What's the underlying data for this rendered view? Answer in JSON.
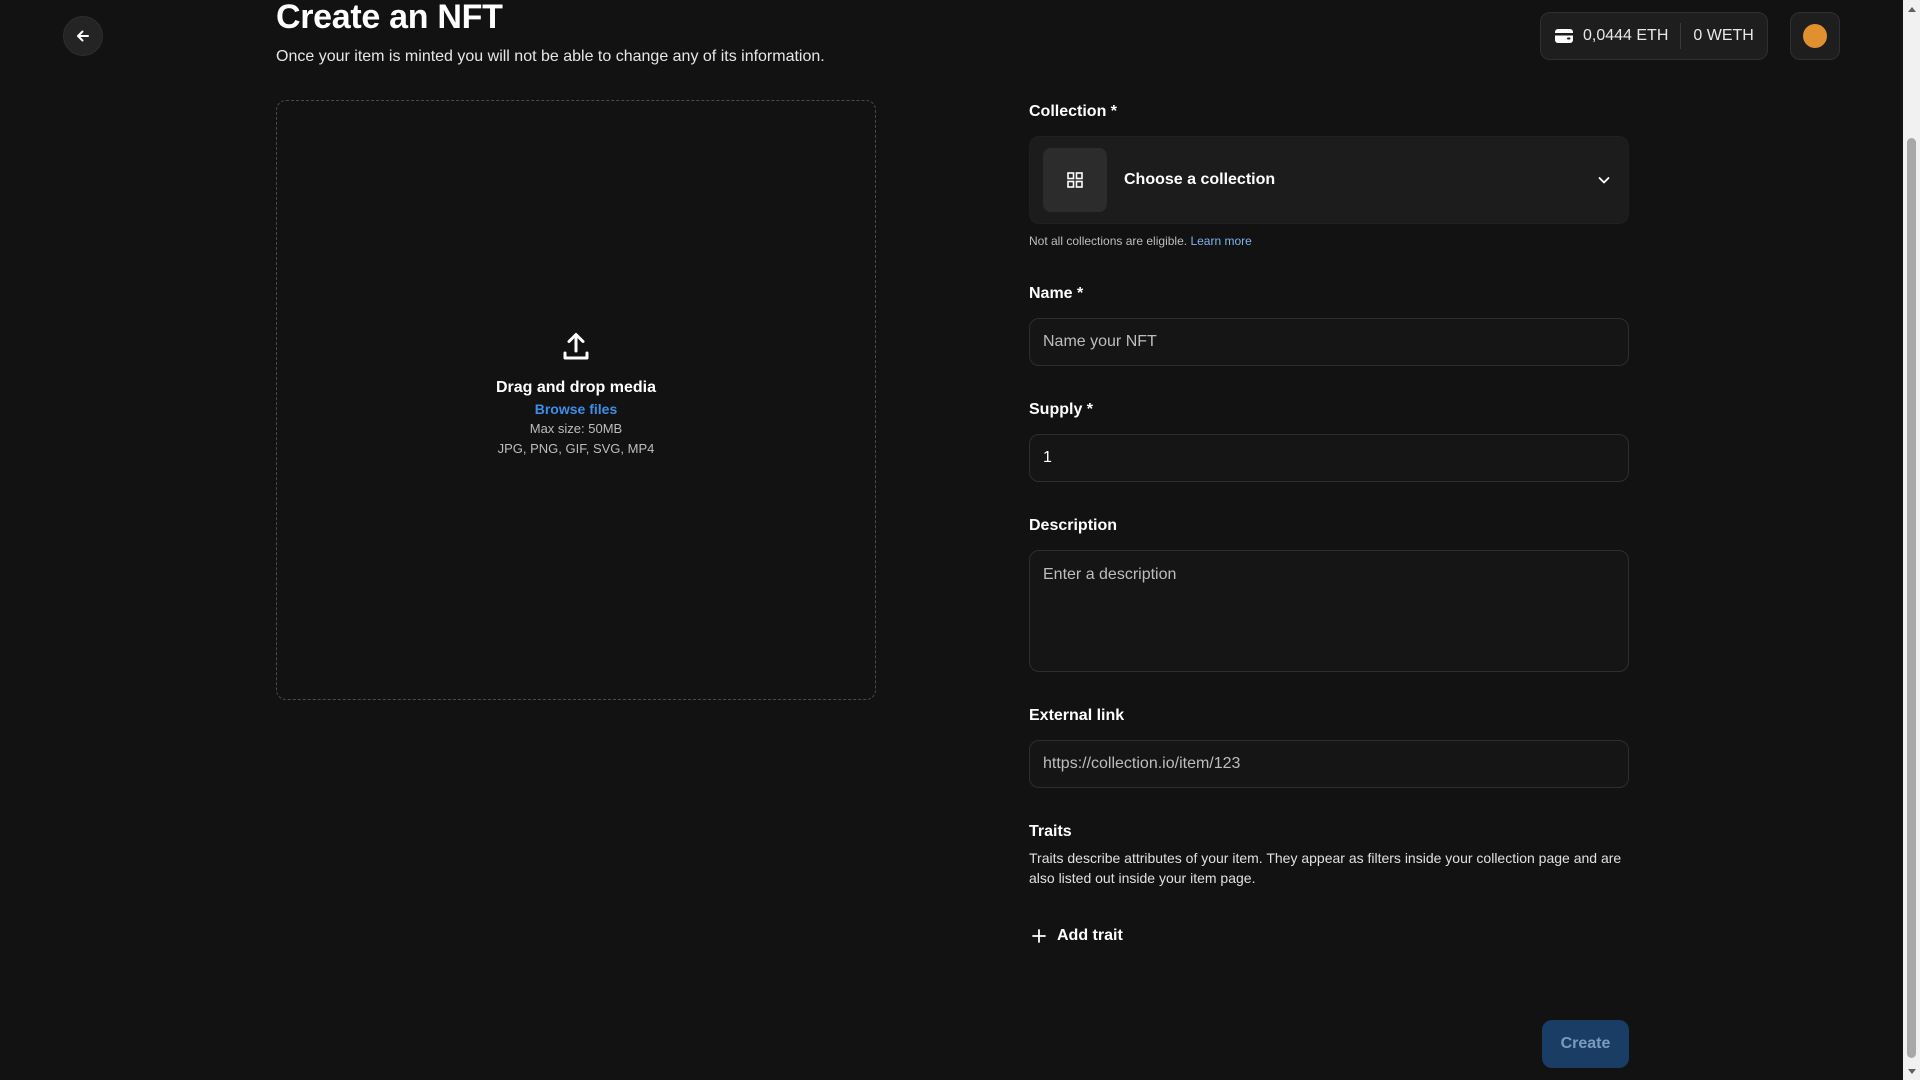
{
  "header": {
    "title": "Create an NFT",
    "subtitle": "Once your item is minted you will not be able to change any of its information.",
    "back_icon": "arrow-left-icon"
  },
  "wallet": {
    "eth_balance": "0,0444 ETH",
    "weth_balance": "0 WETH",
    "wallet_icon": "wallet-icon",
    "avatar_color": "#e0902f"
  },
  "upload": {
    "icon": "upload-icon",
    "title": "Drag and drop media",
    "browse": "Browse files",
    "max_size": "Max size: 50MB",
    "formats": "JPG, PNG, GIF, SVG, MP4"
  },
  "form": {
    "collection": {
      "label": "Collection *",
      "value": "Choose a collection",
      "hint": "Not all collections are eligible.",
      "hint_link": "Learn more"
    },
    "name": {
      "label": "Name *",
      "placeholder": "Name your NFT"
    },
    "supply": {
      "label": "Supply *",
      "value": "1"
    },
    "description": {
      "label": "Description",
      "placeholder": "Enter a description"
    },
    "external_link": {
      "label": "External link",
      "placeholder": "https://collection.io/item/123"
    },
    "traits": {
      "label": "Traits",
      "description": "Traits describe attributes of your item. They appear as filters inside your collection page and are also listed out inside your item page.",
      "add_label": "Add trait"
    },
    "create_label": "Create"
  },
  "colors": {
    "background": "#121212",
    "accent_link": "#3d8ee8",
    "create_button": "#1a3d66"
  }
}
